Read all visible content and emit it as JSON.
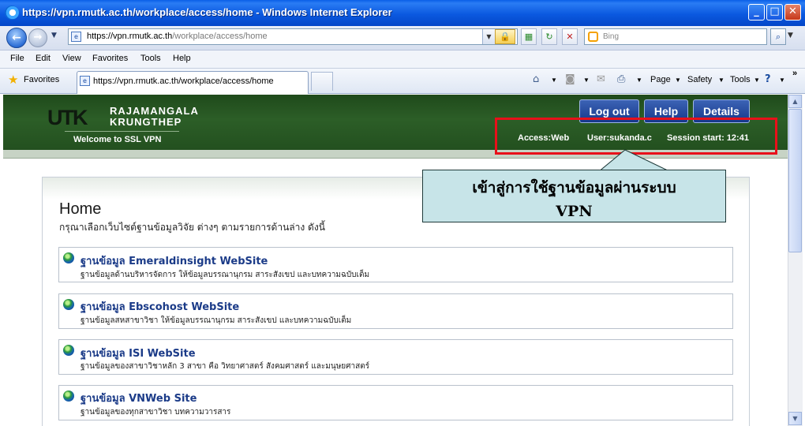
{
  "window": {
    "title": "https://vpn.rmutk.ac.th/workplace/access/home - Windows Internet Explorer"
  },
  "address_bar": {
    "url_host": "https://vpn.rmutk.ac.th",
    "url_path": "/workplace/access/home"
  },
  "search": {
    "placeholder": "Bing"
  },
  "menu": [
    "File",
    "Edit",
    "View",
    "Favorites",
    "Tools",
    "Help"
  ],
  "favorites_bar": {
    "favorites_label": "Favorites",
    "tab_title": "https://vpn.rmutk.ac.th/workplace/access/home",
    "commands": {
      "page": "Page",
      "safety": "Safety",
      "tools": "Tools"
    }
  },
  "header": {
    "logo_mark": "UTK",
    "logo_line1": "RAJAMANGALA",
    "logo_line2": "KRUNGTHEP",
    "welcome": "Welcome to SSL VPN",
    "buttons": {
      "logout": "Log out",
      "help": "Help",
      "details": "Details"
    },
    "info": {
      "access_label": "Access:",
      "access_value": "Web",
      "user_label": "User:",
      "user_value": "sukanda.c",
      "session_label": "Session start:",
      "session_value": "12:41"
    }
  },
  "callout": {
    "line1": "เข้าสู่การใช้ฐานข้อมูลผ่านระบบ",
    "line2": "VPN"
  },
  "main": {
    "title": "Home",
    "description": "กรุณาเลือกเว็บไซต์ฐานข้อมูลวิจัย ต่างๆ ตามรายการด้านล่าง ดังนี้",
    "items": [
      {
        "title": "ฐานข้อมูล Emeraldinsight WebSite",
        "desc": "ฐานข้อมูลด้านบริหารจัดการ ให้ข้อมูลบรรณานุกรม สาระสังเขป และบทความฉบับเต็ม"
      },
      {
        "title": "ฐานข้อมูล Ebscohost WebSite",
        "desc": "ฐานข้อมูลสหสาขาวิชา ให้ข้อมูลบรรณานุกรม สาระสังเขป และบทความฉบับเต็ม"
      },
      {
        "title": "ฐานข้อมูล ISI WebSite",
        "desc": "ฐานข้อมูลของสาขาวิชาหลัก 3 สาขา คือ วิทยาศาสตร์ สังคมศาสตร์ และมนุษยศาสตร์"
      },
      {
        "title": "ฐานข้อมูล VNWeb Site",
        "desc": "ฐานข้อมูลของทุกสาขาวิชา บทความวารสาร"
      }
    ]
  }
}
